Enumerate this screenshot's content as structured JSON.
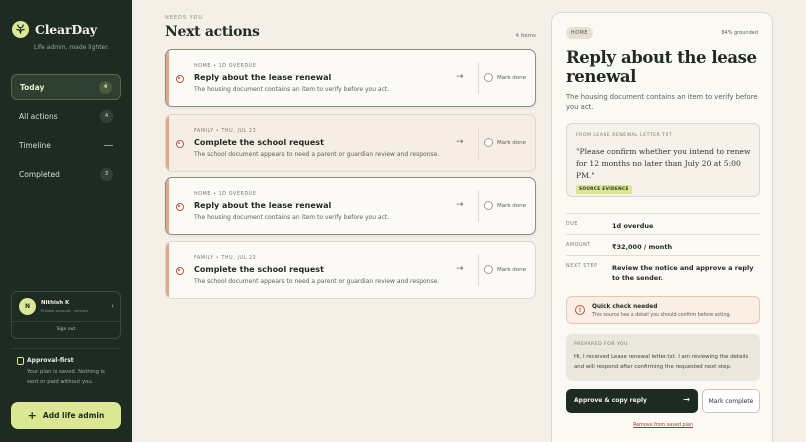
{
  "brand": {
    "name": "ClearDay",
    "tagline": "Life admin, made lighter."
  },
  "nav": [
    {
      "label": "Today",
      "count": "4",
      "active": true
    },
    {
      "label": "All actions",
      "count": "4"
    },
    {
      "label": "Timeline",
      "count": "—"
    },
    {
      "label": "Completed",
      "count": "3"
    }
  ],
  "user": {
    "initial": "N",
    "name": "Nithish K",
    "sub": "Private account · synced",
    "signout": "Sign out"
  },
  "approval": {
    "title": "Approval-first",
    "desc": "Your plan is saved. Nothing is sent or paid without you."
  },
  "add_button": "Add life admin",
  "main": {
    "kicker": "NEEDS YOU",
    "title": "Next actions",
    "count": "4 items"
  },
  "cards": [
    {
      "meta": "HOME  •  1D OVERDUE",
      "title": "Reply about the lease renewal",
      "desc": "The housing document contains an item to verify before you act.",
      "mark": "Mark done"
    },
    {
      "meta": "FAMILY  •  THU, JUL 23",
      "title": "Complete the school request",
      "desc": "The school document appears to need a parent or guardian review and response.",
      "mark": "Mark done"
    },
    {
      "meta": "HOME  •  1D OVERDUE",
      "title": "Reply about the lease renewal",
      "desc": "The housing document contains an item to verify before you act.",
      "mark": "Mark done"
    },
    {
      "meta": "FAMILY  •  THU, JUL 23",
      "title": "Complete the school request",
      "desc": "The school document appears to need a parent or guardian review and response.",
      "mark": "Mark done"
    }
  ],
  "detail": {
    "category": "HOME",
    "grounded": "84% grounded",
    "title": "Reply about the lease renewal",
    "subtitle": "The housing document contains an item to verify before you act.",
    "evidence_label": "FROM LEASE RENEWAL LETTER.TXT",
    "evidence_quote": "\"Please confirm whether you intend to renew for 12 months no later than July 20 at 5:00 PM.\"",
    "evidence_tag": "SOURCE EVIDENCE",
    "due_label": "DUE",
    "due_value": "1d overdue",
    "amount_label": "AMOUNT",
    "amount_value": "₹32,000 / month",
    "next_label": "NEXT STEP",
    "next_value": "Review the notice and approve a reply to the sender.",
    "warn_title": "Quick check needed",
    "warn_desc": "This source has a detail you should confirm before acting.",
    "prepared_label": "PREPARED FOR YOU",
    "prepared_text": "Hi, I received Lease renewal letter.txt. I am reviewing the details and will respond after confirming the requested next step.",
    "approve_label": "Approve & copy reply",
    "complete_label": "Mark complete",
    "remove_label": "Remove from saved plan"
  }
}
